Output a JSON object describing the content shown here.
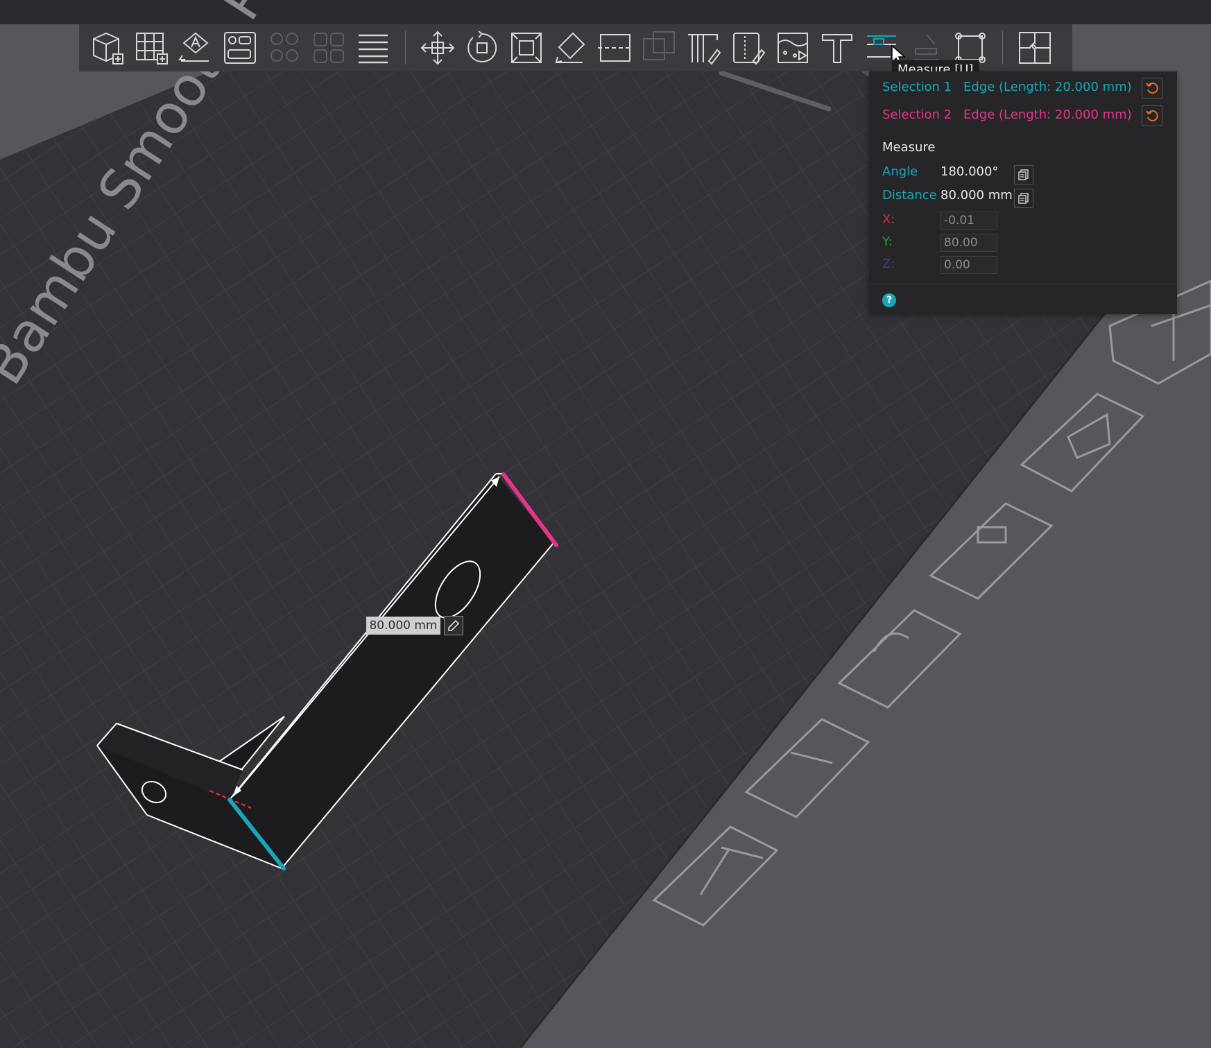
{
  "tooltip": "Measure [U]",
  "panel": {
    "selection1_label": "Selection 1",
    "selection1_value": "Edge (Length: 20.000 mm)",
    "selection2_label": "Selection 2",
    "selection2_value": "Edge (Length: 20.000 mm)",
    "measure_title": "Measure",
    "angle_label": "Angle",
    "angle_value": "180.000°",
    "distance_label": "Distance",
    "distance_value": "80.000 mm",
    "x_label": "X:",
    "x_value": "-0.01",
    "y_label": "Y:",
    "y_value": "80.00",
    "z_label": "Z:",
    "z_value": "0.00",
    "help": "?"
  },
  "viewport": {
    "dimension_label": "80.000 mm",
    "bed_text": "Bambu Smooth PEI Pl"
  },
  "colors": {
    "selection1": "#1aa6b7",
    "selection2": "#e6338a",
    "accent_reset": "#e07020"
  },
  "toolbar_icons": [
    "add-cube-icon",
    "arrange-grid-icon",
    "auto-orient-icon",
    "plate-layout-icon",
    "split-objects-icon",
    "split-parts-icon",
    "layers-icon",
    "move-icon",
    "rotate-icon",
    "scale-icon",
    "lay-on-face-icon",
    "cut-icon",
    "boolean-icon",
    "support-paint-icon",
    "seam-paint-icon",
    "fuzzy-skin-icon",
    "text-icon",
    "measure-icon",
    "assembly-icon",
    "fix-model-icon",
    "plugin-icon"
  ]
}
